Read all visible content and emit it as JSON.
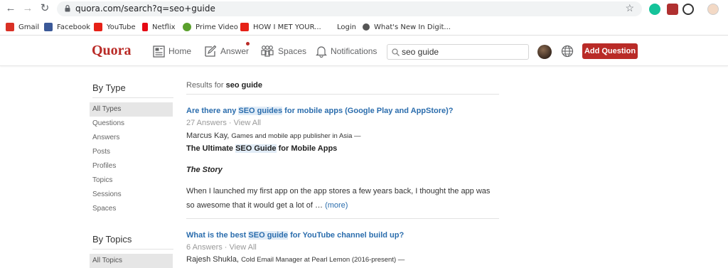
{
  "browser": {
    "url": "quora.com/search?q=seo+guide",
    "bookmarks": [
      {
        "label": "Gmail",
        "icon": "gmail-icon",
        "color": "#d93025"
      },
      {
        "label": "Facebook",
        "icon": "facebook-icon",
        "color": "#3b5998"
      },
      {
        "label": "YouTube",
        "icon": "youtube-icon",
        "color": "#e62117"
      },
      {
        "label": "Netflix",
        "icon": "netflix-icon",
        "color": "#e50914"
      },
      {
        "label": "Prime Video",
        "icon": "prime-video-icon",
        "color": "#5aa02c"
      },
      {
        "label": "HOW I MET YOUR...",
        "icon": "youtube-icon",
        "color": "#e62117"
      },
      {
        "label": "Login",
        "icon": "blank-icon",
        "color": "#ffffff"
      },
      {
        "label": "What's New In Digit...",
        "icon": "digit-icon",
        "color": "#555555"
      }
    ]
  },
  "header": {
    "logo": "Quora",
    "nav": {
      "home": "Home",
      "answer": "Answer",
      "spaces": "Spaces",
      "notifications": "Notifications"
    },
    "search_value": "seo guide",
    "add_question": "Add Question",
    "brand_color": "#b92b27"
  },
  "sidebar": {
    "by_type_title": "By Type",
    "type_items": [
      "All Types",
      "Questions",
      "Answers",
      "Posts",
      "Profiles",
      "Topics",
      "Sessions",
      "Spaces"
    ],
    "by_topics_title": "By Topics",
    "topic_items": [
      "All Topics"
    ]
  },
  "results": {
    "prefix": "Results for",
    "query": "seo guide",
    "items": [
      {
        "title_pre": "Are there any ",
        "title_hl": "SEO guides",
        "title_post": " for mobile apps (Google Play and AppStore)?",
        "meta": "27 Answers · View All",
        "author_name": "Marcus Kay,",
        "author_cred": "Games and mobile app publisher in Asia —",
        "answer_title_pre": "The Ultimate ",
        "answer_title_hl": "SEO Guide",
        "answer_title_post": " for Mobile Apps",
        "story": "The Story",
        "body": "When I launched my first app on the app stores a few years back, I thought the app was so awesome that it would get a lot of …",
        "more": "(more)"
      },
      {
        "title_pre": "What is the best ",
        "title_hl": "SEO guide",
        "title_post": " for YouTube channel build up?",
        "meta": "6 Answers · View All",
        "author_name": "Rajesh Shukla,",
        "author_cred": "Cold Email Manager at Pearl Lemon (2016-present) —"
      }
    ]
  }
}
